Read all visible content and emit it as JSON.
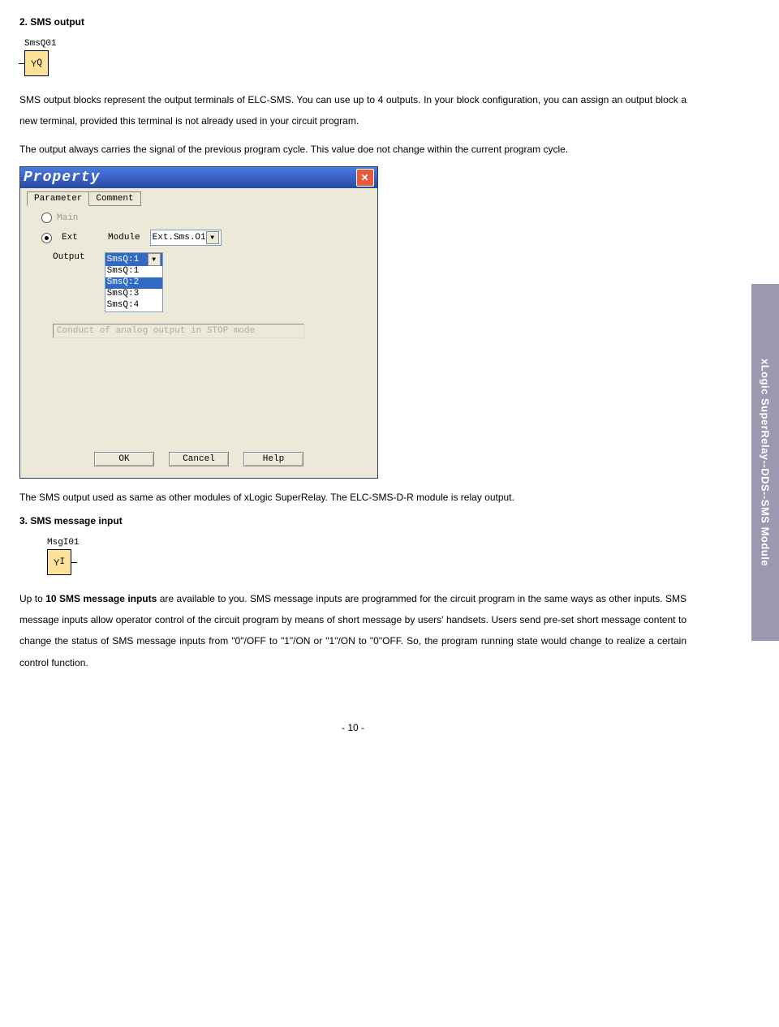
{
  "section2": {
    "heading": "2.  SMS output",
    "block_label": "SmsQ01",
    "block_symbol": "Q",
    "para1": "SMS output blocks represent the output terminals of ELC-SMS. You can use up to 4 outputs. In your block configuration, you can assign an output block a new terminal, provided this terminal is not already used in your circuit program.",
    "para2": "The output always carries the signal of the previous program cycle. This value doe not change within the current program cycle."
  },
  "dialog": {
    "title": "Property",
    "tabs": {
      "t1": "Parameter",
      "t2": "Comment"
    },
    "radio_main": "Main",
    "radio_ext": "Ext",
    "label_module": "Module",
    "combo_module": "Ext.Sms.O1",
    "label_output": "Output",
    "out_sel": "SmsQ:1",
    "out_options": [
      "SmsQ:1",
      "SmsQ:2",
      "SmsQ:3",
      "SmsQ:4"
    ],
    "stop_text": "Conduct of analog output in STOP  mode",
    "btn_ok": "OK",
    "btn_cancel": "Cancel",
    "btn_help": "Help"
  },
  "after_dialog": "The SMS output used as same as other modules of xLogic SuperRelay. The ELC-SMS-D-R module is relay output.",
  "section3": {
    "heading": "3.  SMS message input",
    "block_label": "MsgI01",
    "block_symbol": "I",
    "para_a": "Up to ",
    "para_bold": "10 SMS message inputs",
    "para_b": " are available to you. SMS message inputs are programmed for the circuit program in the same ways as other inputs. SMS message inputs allow operator control of the circuit program by means of short message by users' handsets. Users send pre-set short message content to change the status of SMS message inputs from \"0\"/OFF to \"1\"/ON or \"1\"/ON to \"0\"OFF. So, the program running state would change to realize a certain control function."
  },
  "sidelabel": "xLogic SuperRelay--DDS--SMS Module",
  "pagenum": "- 10 -"
}
